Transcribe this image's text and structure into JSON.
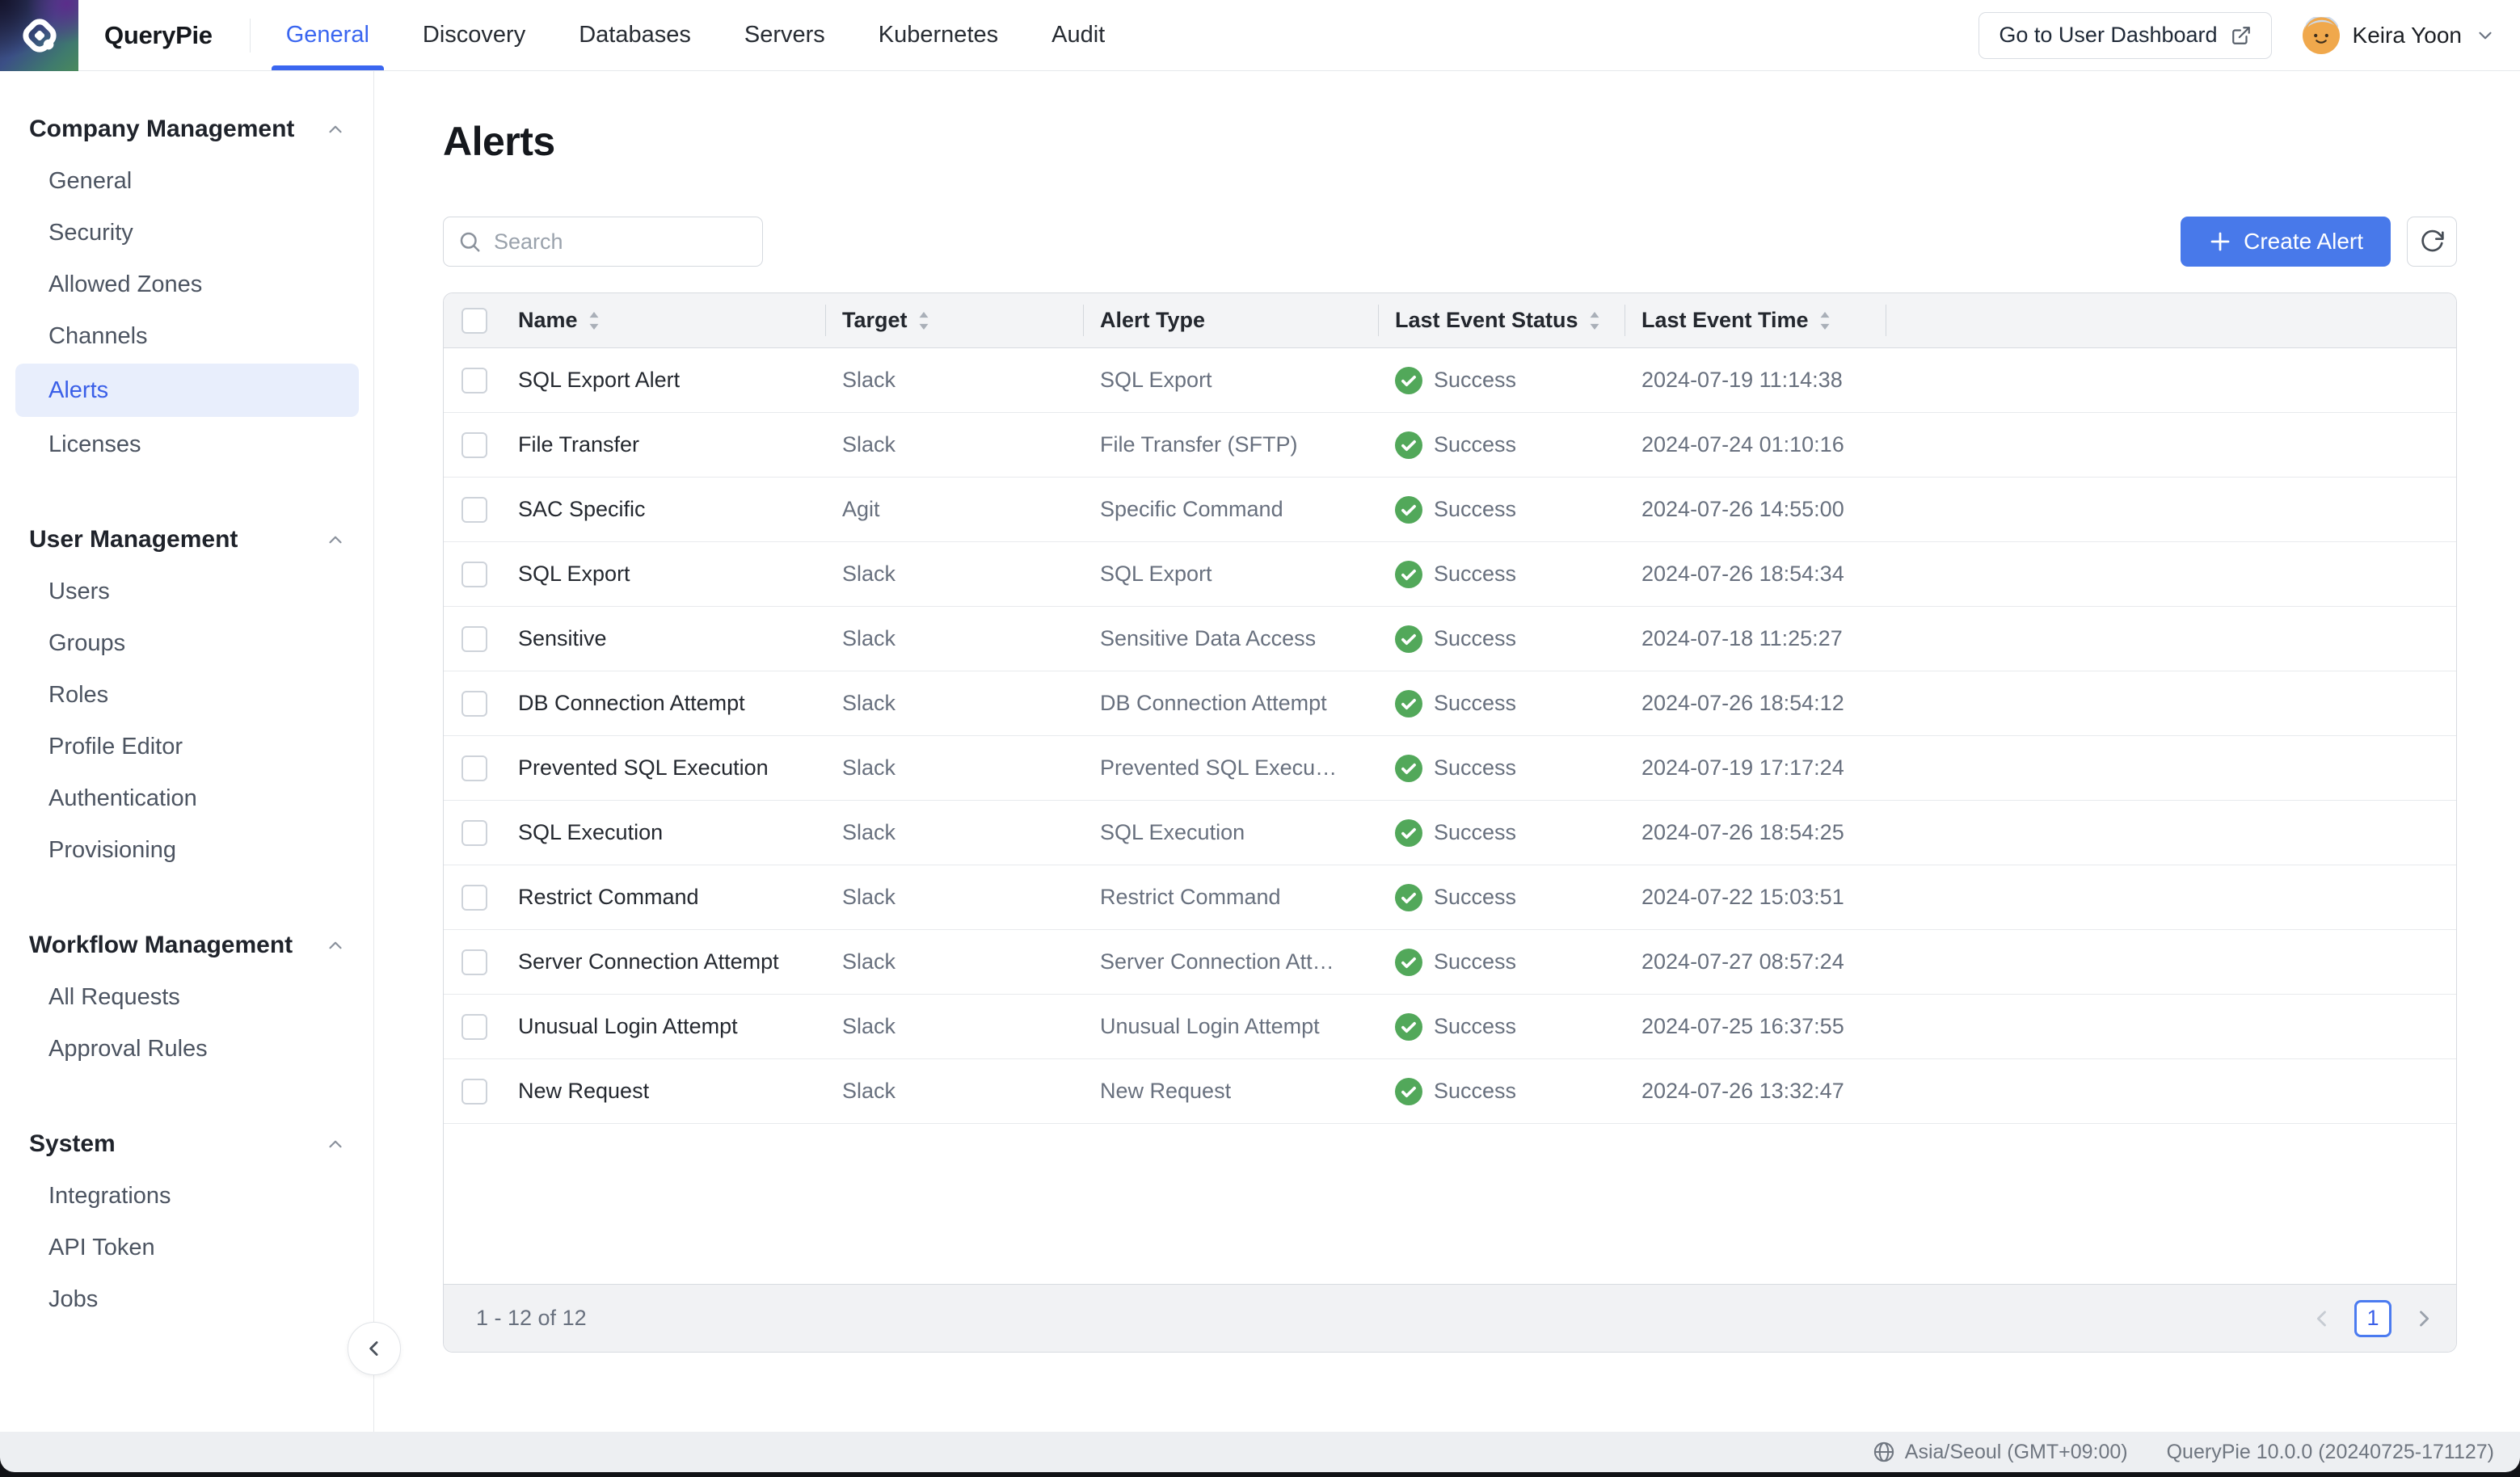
{
  "header": {
    "brand": "QueryPie",
    "tabs": [
      {
        "label": "General",
        "active": true
      },
      {
        "label": "Discovery",
        "active": false
      },
      {
        "label": "Databases",
        "active": false
      },
      {
        "label": "Servers",
        "active": false
      },
      {
        "label": "Kubernetes",
        "active": false
      },
      {
        "label": "Audit",
        "active": false
      }
    ],
    "dashboard_button": "Go to User Dashboard",
    "user_name": "Keira Yoon"
  },
  "sidebar": {
    "sections": [
      {
        "title": "Company Management",
        "items": [
          {
            "label": "General",
            "active": false
          },
          {
            "label": "Security",
            "active": false
          },
          {
            "label": "Allowed Zones",
            "active": false
          },
          {
            "label": "Channels",
            "active": false
          },
          {
            "label": "Alerts",
            "active": true
          },
          {
            "label": "Licenses",
            "active": false
          }
        ]
      },
      {
        "title": "User Management",
        "items": [
          {
            "label": "Users",
            "active": false
          },
          {
            "label": "Groups",
            "active": false
          },
          {
            "label": "Roles",
            "active": false
          },
          {
            "label": "Profile Editor",
            "active": false
          },
          {
            "label": "Authentication",
            "active": false
          },
          {
            "label": "Provisioning",
            "active": false
          }
        ]
      },
      {
        "title": "Workflow Management",
        "items": [
          {
            "label": "All Requests",
            "active": false
          },
          {
            "label": "Approval Rules",
            "active": false
          }
        ]
      },
      {
        "title": "System",
        "items": [
          {
            "label": "Integrations",
            "active": false
          },
          {
            "label": "API Token",
            "active": false
          },
          {
            "label": "Jobs",
            "active": false
          }
        ]
      }
    ]
  },
  "page": {
    "title": "Alerts"
  },
  "toolbar": {
    "search_placeholder": "Search",
    "create_button": "Create Alert"
  },
  "table": {
    "columns": [
      {
        "label": "Name",
        "sortable": true
      },
      {
        "label": "Target",
        "sortable": true
      },
      {
        "label": "Alert Type",
        "sortable": false
      },
      {
        "label": "Last Event Status",
        "sortable": true
      },
      {
        "label": "Last Event Time",
        "sortable": true
      }
    ],
    "rows": [
      {
        "name": "SQL Export Alert",
        "target": "Slack",
        "alert_type": "SQL Export",
        "status": "Success",
        "time": "2024-07-19 11:14:38"
      },
      {
        "name": "File Transfer",
        "target": "Slack",
        "alert_type": "File Transfer (SFTP)",
        "status": "Success",
        "time": "2024-07-24 01:10:16"
      },
      {
        "name": "SAC Specific",
        "target": "Agit",
        "alert_type": "Specific Command",
        "status": "Success",
        "time": "2024-07-26 14:55:00"
      },
      {
        "name": "SQL Export",
        "target": "Slack",
        "alert_type": "SQL Export",
        "status": "Success",
        "time": "2024-07-26 18:54:34"
      },
      {
        "name": "Sensitive",
        "target": "Slack",
        "alert_type": "Sensitive Data Access",
        "status": "Success",
        "time": "2024-07-18 11:25:27"
      },
      {
        "name": "DB Connection Attempt",
        "target": "Slack",
        "alert_type": "DB Connection Attempt",
        "status": "Success",
        "time": "2024-07-26 18:54:12"
      },
      {
        "name": "Prevented SQL Execution",
        "target": "Slack",
        "alert_type": "Prevented SQL Execution",
        "status": "Success",
        "time": "2024-07-19 17:17:24"
      },
      {
        "name": "SQL Execution",
        "target": "Slack",
        "alert_type": "SQL Execution",
        "status": "Success",
        "time": "2024-07-26 18:54:25"
      },
      {
        "name": "Restrict Command",
        "target": "Slack",
        "alert_type": "Restrict Command",
        "status": "Success",
        "time": "2024-07-22 15:03:51"
      },
      {
        "name": "Server Connection Attempt",
        "target": "Slack",
        "alert_type": "Server Connection Attempt",
        "status": "Success",
        "time": "2024-07-27 08:57:24"
      },
      {
        "name": "Unusual Login Attempt",
        "target": "Slack",
        "alert_type": "Unusual Login Attempt",
        "status": "Success",
        "time": "2024-07-25 16:37:55"
      },
      {
        "name": "New Request",
        "target": "Slack",
        "alert_type": "New Request",
        "status": "Success",
        "time": "2024-07-26 13:32:47"
      }
    ]
  },
  "pagination": {
    "range": "1 - 12 of 12",
    "page": "1"
  },
  "status_bar": {
    "timezone": "Asia/Seoul (GMT+09:00)",
    "version": "QueryPie 10.0.0 (20240725-171127)"
  },
  "colors": {
    "accent": "#3a66f0",
    "button_blue": "#4879ea",
    "success_green": "#52a85a",
    "active_item_bg": "#e8eefc"
  }
}
